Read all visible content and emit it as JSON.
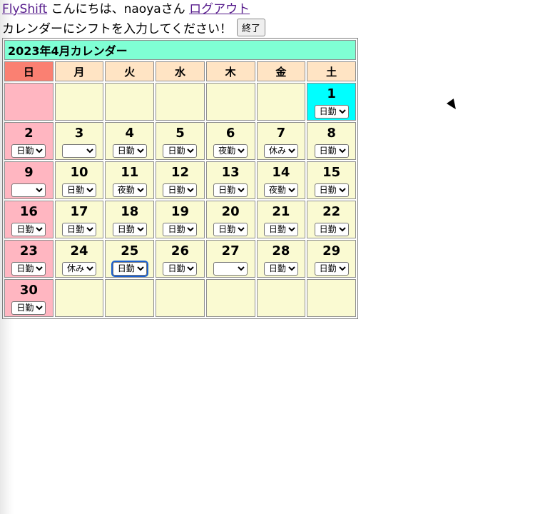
{
  "header": {
    "app_link": "FlyShift",
    "greeting": "こんにちは、naoyaさん",
    "logout_link": "ログアウト",
    "instruction": "カレンダーにシフトを入力してください！",
    "finish_button": "終了"
  },
  "calendar": {
    "title": "2023年4月カレンダー",
    "weekdays": [
      "日",
      "月",
      "火",
      "水",
      "木",
      "金",
      "土"
    ],
    "shift_options": [
      "",
      "日勤",
      "夜勤",
      "休み"
    ],
    "weeks": [
      [
        null,
        null,
        null,
        null,
        null,
        null,
        {
          "day": "1",
          "shift": "日勤",
          "today": true
        }
      ],
      [
        {
          "day": "2",
          "shift": "日勤"
        },
        {
          "day": "3",
          "shift": ""
        },
        {
          "day": "4",
          "shift": "日勤"
        },
        {
          "day": "5",
          "shift": "日勤"
        },
        {
          "day": "6",
          "shift": "夜勤"
        },
        {
          "day": "7",
          "shift": "休み"
        },
        {
          "day": "8",
          "shift": "日勤"
        }
      ],
      [
        {
          "day": "9",
          "shift": ""
        },
        {
          "day": "10",
          "shift": "日勤"
        },
        {
          "day": "11",
          "shift": "夜勤"
        },
        {
          "day": "12",
          "shift": "日勤"
        },
        {
          "day": "13",
          "shift": "日勤"
        },
        {
          "day": "14",
          "shift": "夜勤"
        },
        {
          "day": "15",
          "shift": "日勤"
        }
      ],
      [
        {
          "day": "16",
          "shift": "日勤"
        },
        {
          "day": "17",
          "shift": "日勤"
        },
        {
          "day": "18",
          "shift": "日勤"
        },
        {
          "day": "19",
          "shift": "日勤"
        },
        {
          "day": "20",
          "shift": "日勤"
        },
        {
          "day": "21",
          "shift": "日勤"
        },
        {
          "day": "22",
          "shift": "日勤"
        }
      ],
      [
        {
          "day": "23",
          "shift": "日勤"
        },
        {
          "day": "24",
          "shift": "休み"
        },
        {
          "day": "25",
          "shift": "日勤",
          "focused": true
        },
        {
          "day": "26",
          "shift": "日勤"
        },
        {
          "day": "27",
          "shift": ""
        },
        {
          "day": "28",
          "shift": "日勤"
        },
        {
          "day": "29",
          "shift": "日勤"
        }
      ],
      [
        {
          "day": "30",
          "shift": "日勤"
        },
        null,
        null,
        null,
        null,
        null,
        null
      ]
    ]
  },
  "colors": {
    "title_bg": "#7fffd4",
    "header_bg": "#ffe4c4",
    "sunday_header_bg": "#fa8072",
    "day_bg": "#fafad2",
    "sunday_bg": "#ffb6c1",
    "today_bg": "#00ffff"
  }
}
